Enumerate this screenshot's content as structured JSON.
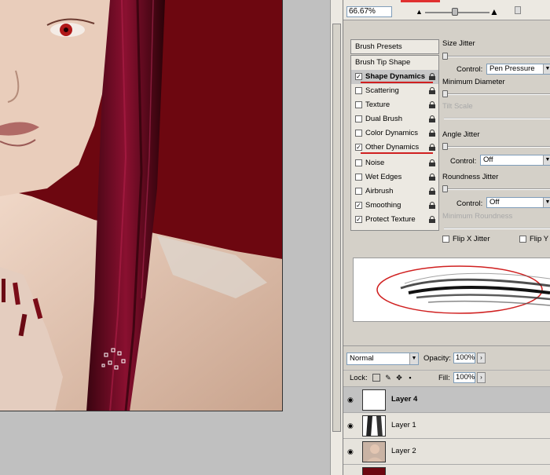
{
  "navigator": {
    "zoom_value": "66.67%",
    "zoom_out_icon": "small-mountain-icon",
    "zoom_in_icon": "large-mountain-icon"
  },
  "brushes": {
    "brush_presets": "Brush Presets",
    "brush_tip_shape": "Brush Tip Shape",
    "options": [
      {
        "label": "Shape Dynamics",
        "checked": true,
        "selected": true
      },
      {
        "label": "Scattering",
        "checked": false,
        "selected": false
      },
      {
        "label": "Texture",
        "checked": false,
        "selected": false
      },
      {
        "label": "Dual Brush",
        "checked": false,
        "selected": false
      },
      {
        "label": "Color Dynamics",
        "checked": false,
        "selected": false
      },
      {
        "label": "Other Dynamics",
        "checked": true,
        "selected": false
      },
      {
        "label": "Noise",
        "checked": false,
        "selected": false
      },
      {
        "label": "Wet Edges",
        "checked": false,
        "selected": false
      },
      {
        "label": "Airbrush",
        "checked": false,
        "selected": false
      },
      {
        "label": "Smoothing",
        "checked": true,
        "selected": false
      },
      {
        "label": "Protect Texture",
        "checked": true,
        "selected": false
      }
    ],
    "controls": {
      "size_jitter": "Size Jitter",
      "control_label": "Control:",
      "size_control_value": "Pen Pressure",
      "minimum_diameter": "Minimum Diameter",
      "tilt_scale": "Tilt Scale",
      "angle_jitter": "Angle Jitter",
      "angle_control_value": "Off",
      "roundness_jitter": "Roundness Jitter",
      "roundness_control_value": "Off",
      "minimum_roundness": "Minimum Roundness",
      "flip_x": "Flip X Jitter",
      "flip_y": "Flip Y Jitter"
    }
  },
  "layers": {
    "blend_mode": "Normal",
    "opacity_label": "Opacity:",
    "opacity_value": "100%",
    "lock_label": "Lock:",
    "fill_label": "Fill:",
    "fill_value": "100%",
    "items": [
      {
        "name": "Layer 4",
        "active": true,
        "thumb": "transparent"
      },
      {
        "name": "Layer 1",
        "active": false,
        "thumb": "hair"
      },
      {
        "name": "Layer 2",
        "active": false,
        "thumb": "portrait"
      }
    ]
  },
  "colors": {
    "canvas_background": "#6d0710",
    "hair": "#5a0820",
    "skin": "#e6c8b4",
    "annotation_red": "#d02020"
  }
}
